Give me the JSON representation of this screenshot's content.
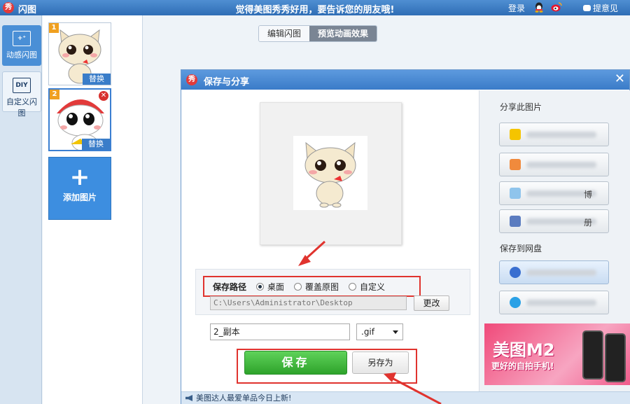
{
  "app": {
    "title": "闪图",
    "logo_char": "秀",
    "tagline": "觉得美图秀秀好用，要告诉您的朋友哦!",
    "login": "登录",
    "feedback": "提意见"
  },
  "modes": [
    {
      "label": "动感闪图",
      "icon": "flash-image-icon"
    },
    {
      "label": "自定义闪图",
      "icon_text": "DIY"
    }
  ],
  "frames": [
    {
      "number": "1",
      "replace_label": "替换"
    },
    {
      "number": "2",
      "replace_label": "替换",
      "close": "✕"
    }
  ],
  "add_image": {
    "plus": "+",
    "label": "添加图片"
  },
  "view_tabs": {
    "edit": "编辑闪图",
    "preview": "预览动画效果"
  },
  "dialog": {
    "title": "保存与分享",
    "close": "✕",
    "save_path_label": "保存路径",
    "options": [
      {
        "label": "桌面",
        "selected": true
      },
      {
        "label": "覆盖原图",
        "selected": false
      },
      {
        "label": "自定义",
        "selected": false
      }
    ],
    "path_value": "C:\\Users\\Administrator\\Desktop",
    "change_label": "更改",
    "filename": "2_副本",
    "format": ".gif",
    "save_label": "保存",
    "save_as_label": "另存为",
    "status_text": "美图达人最爱单品今日上新!"
  },
  "share": {
    "share_heading": "分享此图片",
    "share_buttons": [
      {
        "icon": "qzone-icon",
        "label": ""
      },
      {
        "icon": "renren-icon",
        "label": ""
      },
      {
        "icon": "weibo-icon",
        "label": "博"
      },
      {
        "icon": "album-icon",
        "label": "册"
      }
    ],
    "netdisk_heading": "保存到网盘",
    "netdisk_buttons": [
      {
        "icon": "netdisk-icon",
        "label": ""
      },
      {
        "icon": "bird-icon",
        "label": ""
      }
    ],
    "ad_title": "美图M2",
    "ad_sub": "更好的自拍手机!"
  },
  "colors": {
    "highlight": "#e0332e",
    "save_green": "#2ea32b",
    "titlebar": "#3a7bc8"
  }
}
